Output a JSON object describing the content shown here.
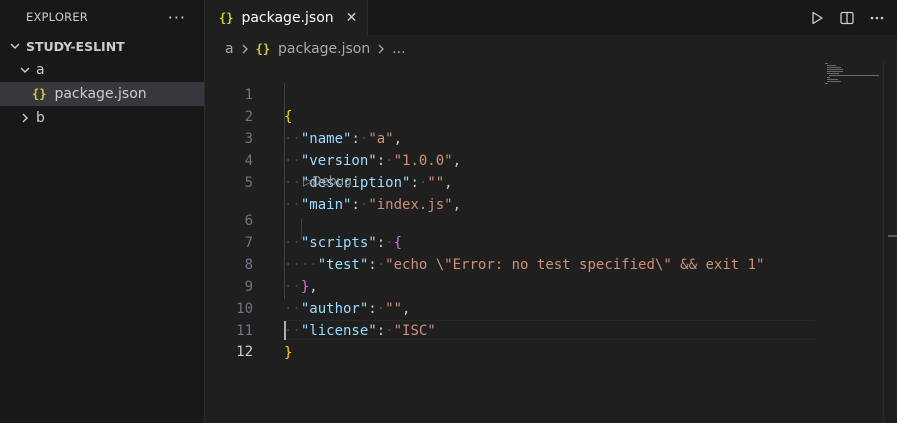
{
  "explorer": {
    "title": "EXPLORER",
    "more": "···",
    "root_folder": "STUDY-ESLINT",
    "items": [
      {
        "label": "a"
      },
      {
        "label": "package.json",
        "icon": "{}"
      },
      {
        "label": "b"
      }
    ]
  },
  "tab": {
    "icon": "{}",
    "label": "package.json",
    "close": "✕"
  },
  "breadcrumb": {
    "folder": "a",
    "icon": "{}",
    "file": "package.json",
    "more": "..."
  },
  "codelens": "Debug",
  "editor": {
    "line_numbers": [
      "1",
      "2",
      "3",
      "4",
      "5",
      "6",
      "7",
      "8",
      "9",
      "10",
      "11",
      "12"
    ],
    "tokens": {
      "l1_open": "{",
      "l2_key": "\"name\"",
      "l2_val": "\"a\"",
      "l3_key": "\"version\"",
      "l3_val": "\"1.0.0\"",
      "l4_key": "\"description\"",
      "l4_val": "\"\"",
      "l5_key": "\"main\"",
      "l5_val": "\"index.js\"",
      "l6_key": "\"scripts\"",
      "l6_open": "{",
      "l7_key": "\"test\"",
      "l7_val": "\"echo \\\"Error: no test specified\\\" && exit 1\"",
      "l8_close": "}",
      "l9_key": "\"author\"",
      "l9_val": "\"\"",
      "l10_key": "\"license\"",
      "l10_val": "\"ISC\"",
      "l11_close": "}"
    }
  },
  "colors": {
    "background": "#1f1f1f",
    "sidebar": "#181818",
    "selection": "#37373d",
    "json_icon": "#cbcb41",
    "key": "#9cdcfe",
    "string": "#ce9178",
    "brace_level1": "#ffd700",
    "brace_level2": "#da70d6"
  },
  "icons": {
    "more": "ellipsis-icon",
    "chevron_down": "chevron-down-icon",
    "chevron_right": "chevron-right-icon",
    "json": "json-file-icon",
    "close": "close-icon",
    "run": "play-icon",
    "split": "split-editor-icon",
    "actions": "ellipsis-icon"
  }
}
